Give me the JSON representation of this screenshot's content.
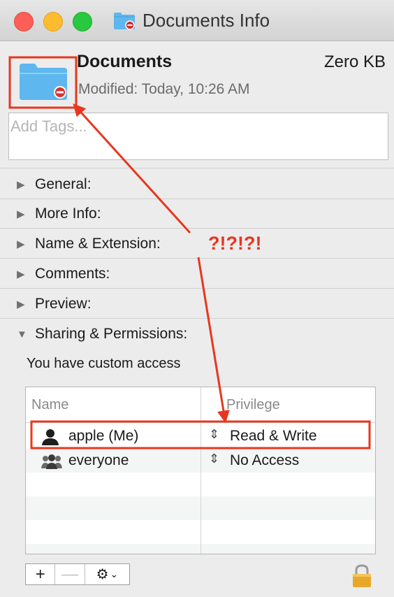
{
  "window": {
    "title": "Documents Info"
  },
  "header": {
    "name": "Documents",
    "size": "Zero KB",
    "modified": "Modified: Today, 10:26 AM"
  },
  "tags": {
    "placeholder": "Add Tags..."
  },
  "sections": [
    {
      "label": "General:",
      "expanded": false
    },
    {
      "label": "More Info:",
      "expanded": false
    },
    {
      "label": "Name & Extension:",
      "expanded": false
    },
    {
      "label": "Comments:",
      "expanded": false
    },
    {
      "label": "Preview:",
      "expanded": false
    },
    {
      "label": "Sharing & Permissions:",
      "expanded": true
    }
  ],
  "sharing": {
    "access_note": "You have custom access",
    "columns": {
      "name": "Name",
      "privilege": "Privilege"
    },
    "rows": [
      {
        "name": "apple (Me)",
        "privilege": "Read & Write",
        "icon": "user-icon"
      },
      {
        "name": "everyone",
        "privilege": "No Access",
        "icon": "group-icon"
      }
    ]
  },
  "toolbar": {
    "add_label": "+",
    "remove_label": "—",
    "action_icon": "gear-icon",
    "lock_icon": "lock-icon"
  },
  "annotation": {
    "text": "?!?!?!"
  },
  "colors": {
    "annotation": "#e8361e",
    "folder": "#5eb7ee",
    "badge": "#d9302a"
  }
}
